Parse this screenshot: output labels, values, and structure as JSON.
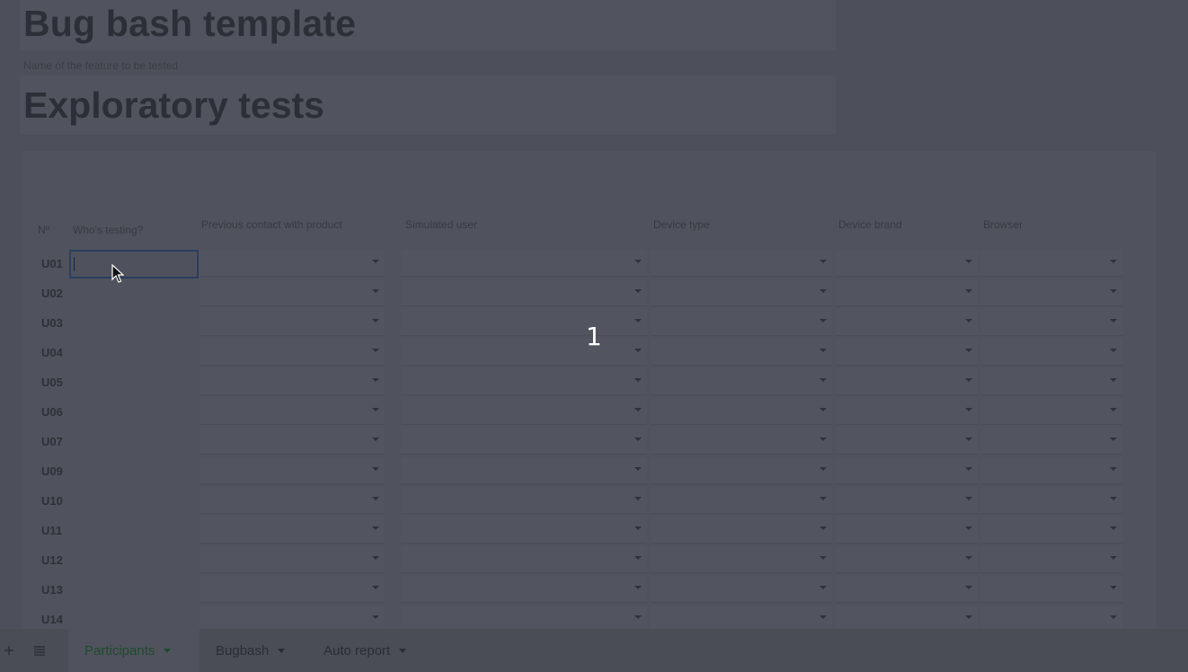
{
  "document": {
    "title": "Bug bash template",
    "subtitle": "Name of the feature to be tested",
    "section_title": "Exploratory tests"
  },
  "table": {
    "headers": {
      "number": "Nº",
      "tester": "Who's testing?",
      "previous_contact": "Previous contact with product",
      "simulated_user": "Simulated user",
      "device_type": "Device type",
      "device_brand": "Device brand",
      "browser": "Browser"
    },
    "rows": [
      "U01",
      "U02",
      "U03",
      "U04",
      "U05",
      "U06",
      "U07",
      "U09",
      "U10",
      "U11",
      "U12",
      "U13",
      "U14"
    ]
  },
  "overlay": {
    "step_number": "1"
  },
  "tabbar": {
    "add_icon": "plus-icon",
    "list_icon": "list-icon",
    "tabs": [
      {
        "label": "Participants",
        "active": true
      },
      {
        "label": "Bugbash",
        "active": false
      },
      {
        "label": "Auto report",
        "active": false
      }
    ]
  },
  "colors": {
    "active_tab_text": "#1f4a2f",
    "selection_border": "#2a3e5e"
  }
}
